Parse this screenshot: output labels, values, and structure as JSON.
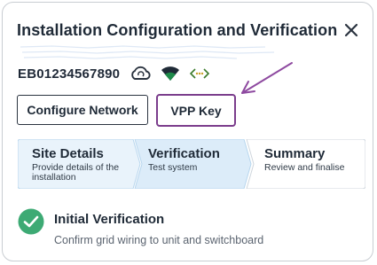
{
  "dialog": {
    "title": "Installation Configuration and Verification",
    "close_icon": "close-icon"
  },
  "device": {
    "serial": "EB01234567890",
    "status_icons": [
      "cloud-sync-icon",
      "wifi-icon",
      "network-connection-icon"
    ]
  },
  "buttons": {
    "configure_network": "Configure Network",
    "vpp_key": "VPP Key"
  },
  "annotation": {
    "arrow_color": "#8e4aa0",
    "highlight_color": "#7b3d8c"
  },
  "stepper": {
    "steps": [
      {
        "title": "Site Details",
        "subtitle": "Provide details of the installation",
        "subtitle_line1": "Provide details of the",
        "subtitle_line2": "installation",
        "state": "complete"
      },
      {
        "title": "Verification",
        "subtitle": "Test system",
        "state": "active"
      },
      {
        "title": "Summary",
        "subtitle": "Review and finalise",
        "state": "pending"
      }
    ],
    "colors": {
      "complete": "#e9f3fb",
      "active": "#dcecf9",
      "pending": "#ffffff",
      "border": "#b8d6ee"
    }
  },
  "verification": {
    "title": "Initial Verification",
    "description": "Confirm grid wiring to unit and switchboard",
    "status_color": "#3daa74",
    "status_icon": "check-icon"
  }
}
